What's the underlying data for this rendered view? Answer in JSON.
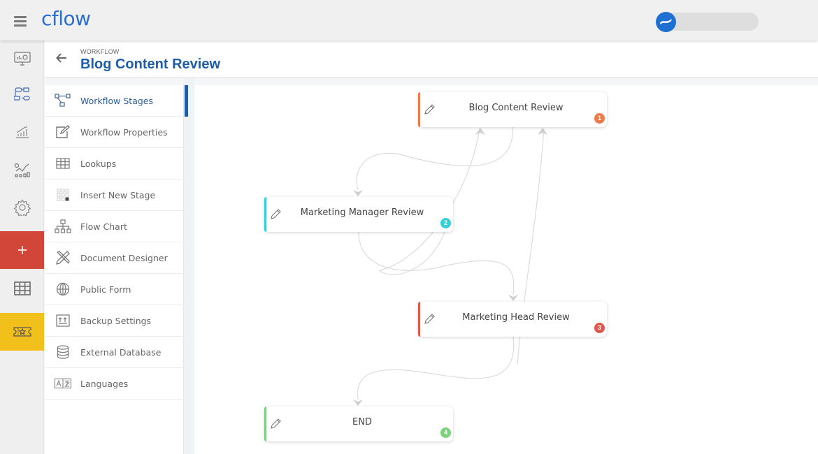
{
  "app": {
    "logo_text": "cflow",
    "menu_icon": "hamburger-icon",
    "user_avatar_icon": "cflow-wave-avatar-icon"
  },
  "rail": {
    "items": [
      {
        "name": "dashboard",
        "icon": "monitor-dashboard-icon"
      },
      {
        "name": "workflows",
        "icon": "workflow-process-icon"
      },
      {
        "name": "reports",
        "icon": "bar-chart-growth-icon"
      },
      {
        "name": "analytics",
        "icon": "analytics-chart-icon"
      },
      {
        "name": "settings",
        "icon": "gear-icon"
      },
      {
        "name": "add",
        "icon": "plus-icon",
        "label": "+"
      },
      {
        "name": "grid",
        "icon": "grid-icon"
      },
      {
        "name": "ticket",
        "icon": "ticket-star-icon"
      }
    ],
    "colors": {
      "add_bg": "#d2463a",
      "ticket_bg": "#f2c01b"
    }
  },
  "header": {
    "breadcrumb": "WORKFLOW",
    "title": "Blog Content Review",
    "back_icon": "arrow-left-icon"
  },
  "subnav": {
    "items": [
      {
        "label": "Workflow Stages",
        "icon": "workflow-stages-icon",
        "active": true
      },
      {
        "label": "Workflow Properties",
        "icon": "edit-square-icon",
        "active": false
      },
      {
        "label": "Lookups",
        "icon": "table-icon",
        "active": false
      },
      {
        "label": "Insert New Stage",
        "icon": "insert-grid-icon",
        "active": false
      },
      {
        "label": "Flow Chart",
        "icon": "hierarchy-icon",
        "active": false
      },
      {
        "label": "Document Designer",
        "icon": "design-tools-icon",
        "active": false
      },
      {
        "label": "Public Form",
        "icon": "globe-icon",
        "active": false
      },
      {
        "label": "Backup Settings",
        "icon": "upload-backup-icon",
        "active": false
      },
      {
        "label": "External Database",
        "icon": "database-icon",
        "active": false
      },
      {
        "label": "Languages",
        "icon": "language-icon",
        "active": false
      }
    ]
  },
  "stages": [
    {
      "title": "Blog Content Review",
      "number": "1",
      "color": "#ee7a4a"
    },
    {
      "title": "Marketing Manager Review",
      "number": "2",
      "color": "#35cfd8"
    },
    {
      "title": "Marketing Head Review",
      "number": "3",
      "color": "#e2574c"
    },
    {
      "title": "END",
      "number": "4",
      "color": "#7ccf7d"
    }
  ]
}
